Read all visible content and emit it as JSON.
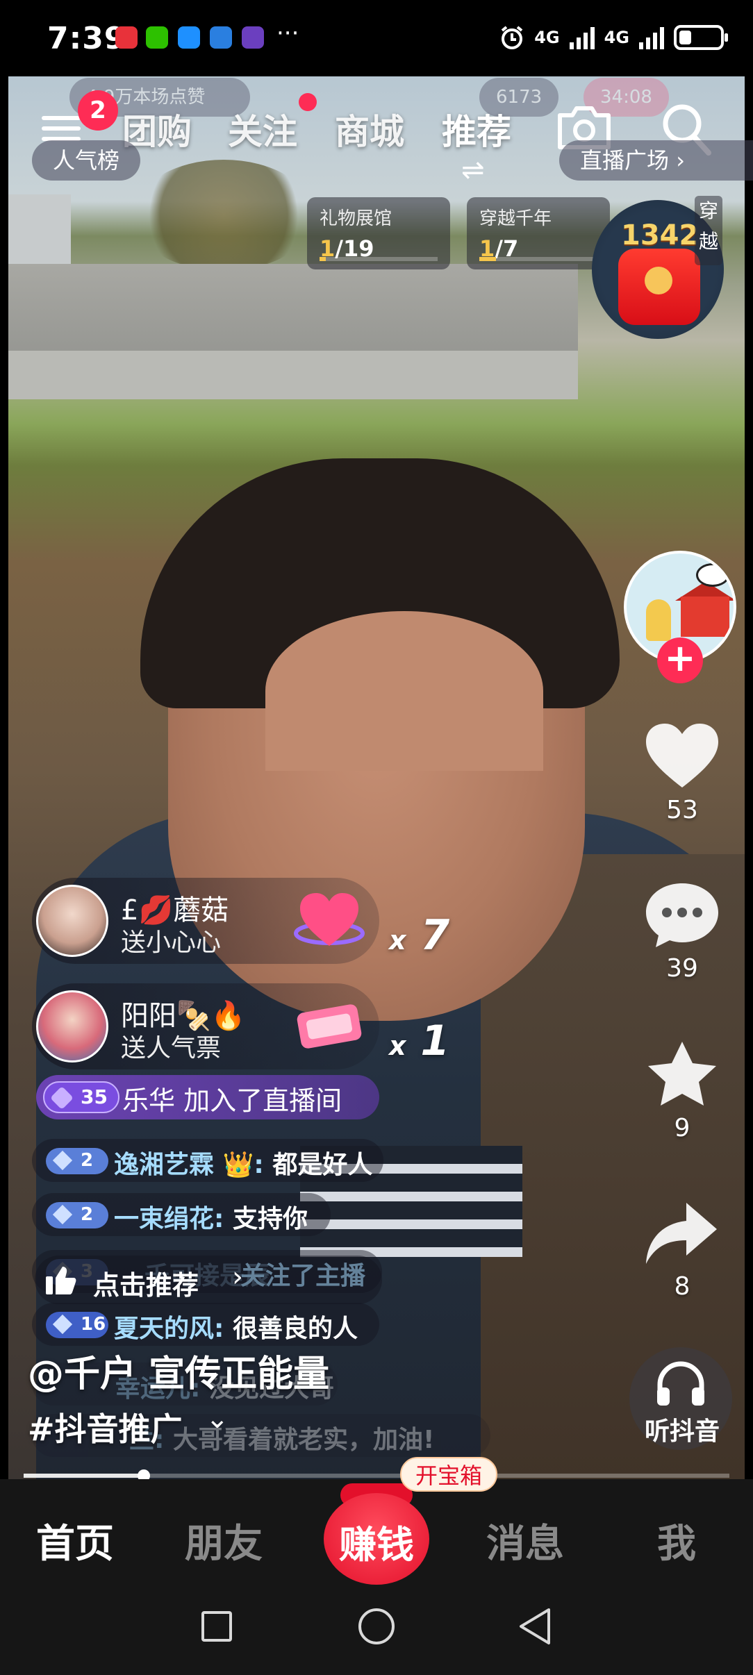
{
  "status": {
    "time": "7:39",
    "net1": "4G",
    "net2": "4G",
    "more": "···",
    "battery_level": 0.3
  },
  "top": {
    "strip_count": "6173",
    "strip_timer": "34:08",
    "strip_likes": "4.9万本场点赞",
    "menu_badge": "2",
    "tabs": [
      "团购",
      "关注",
      "商城",
      "推荐"
    ],
    "rank_label": "人气榜",
    "plaza_label": "直播广场",
    "plaza_chev": "›"
  },
  "activities": [
    {
      "title": "礼物展馆",
      "current": "1",
      "total": "/19",
      "progress": 0.05
    },
    {
      "title": "穿越千年",
      "current": "1",
      "total": "/7",
      "progress": 0.14
    }
  ],
  "redpack": {
    "count": "1342",
    "side_tag": "穿越"
  },
  "rail": {
    "likes": "53",
    "comments": "39",
    "favorites": "9",
    "shares": "8",
    "listen_label": "听抖音"
  },
  "gifts": [
    {
      "user": "£💋蘑菇",
      "action": "送小心心",
      "count": "7",
      "x": "x"
    },
    {
      "user": "阳阳🍢🔥",
      "action": "送人气票",
      "count": "1",
      "x": "x"
    }
  ],
  "join": {
    "level": "35",
    "text": "乐华 加入了直播间"
  },
  "chats": [
    {
      "level": "2",
      "user": "逸湘艺霖 👑:",
      "message": "都是好人"
    },
    {
      "level": "2",
      "user": "一束绢花:",
      "message": "支持你"
    },
    {
      "level": "3",
      "user": "千可接是辰",
      "message": "关注了主播"
    },
    {
      "level": "16",
      "user": "夏天的风:",
      "message": "很善良的人"
    },
    {
      "level": "",
      "user": "幸运儿:",
      "message": "没见过大哥"
    },
    {
      "level": "",
      "user": "兰:",
      "message": "大哥看着就老实，加油!"
    }
  ],
  "recommend": {
    "label": "点击推荐",
    "chev": "›"
  },
  "author": "@千户 宣传正能量",
  "hashtag": "#抖音推广",
  "progress": 0.17,
  "nav": {
    "tabs": [
      "首页",
      "朋友",
      "消息",
      "我"
    ],
    "earn": "赚钱",
    "treasure": "开宝箱"
  },
  "colors": {
    "accent": "#fe2c55",
    "earn": "#e3102b",
    "gold": "#f5c54c"
  }
}
